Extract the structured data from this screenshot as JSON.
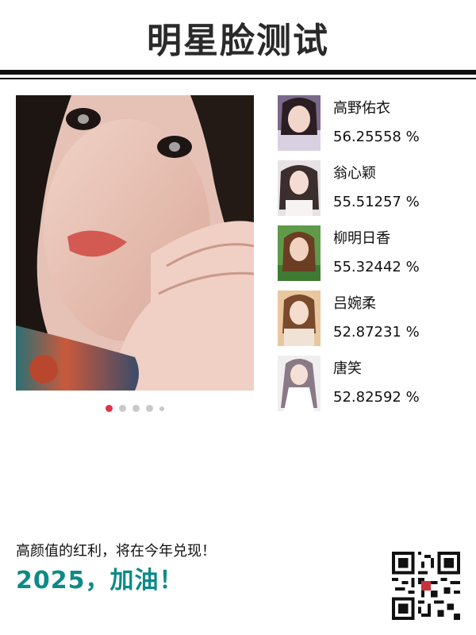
{
  "header": {
    "title": "明星脸测试"
  },
  "carousel": {
    "slide_count": 5,
    "active_index": 0
  },
  "matches": [
    {
      "name": "高野佑衣",
      "score": "56.25558 %"
    },
    {
      "name": "翁心颖",
      "score": "55.51257 %"
    },
    {
      "name": "柳明日香",
      "score": "55.32442 %"
    },
    {
      "name": "吕婉柔",
      "score": "52.87231 %"
    },
    {
      "name": "唐笑",
      "score": "52.82592 %"
    }
  ],
  "footer": {
    "slogan": "高颜值的红利，将在今年兑现！",
    "headline": "2025，加油！"
  },
  "colors": {
    "accent": "#0d8a88",
    "active_dot": "#e0324b"
  }
}
